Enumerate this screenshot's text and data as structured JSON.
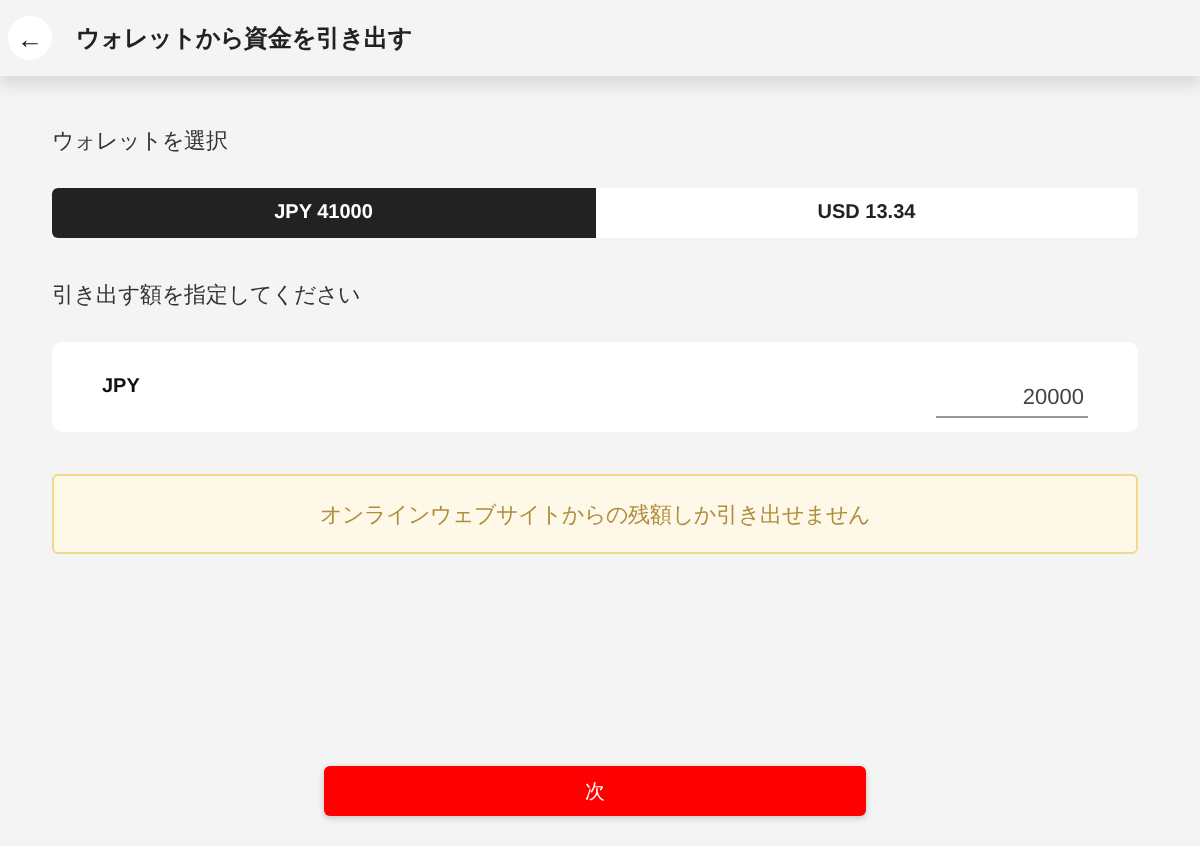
{
  "header": {
    "back_icon": "←",
    "title": "ウォレットから資金を引き出す"
  },
  "wallet_label": "ウォレットを選択",
  "wallets": [
    {
      "label": "JPY 41000",
      "selected": true
    },
    {
      "label": "USD 13.34",
      "selected": false
    }
  ],
  "amount_label": "引き出す額を指定してください",
  "amount": {
    "currency": "JPY",
    "value": "20000"
  },
  "notice": "オンラインウェブサイトからの残額しか引き出せません",
  "next_button": "次"
}
